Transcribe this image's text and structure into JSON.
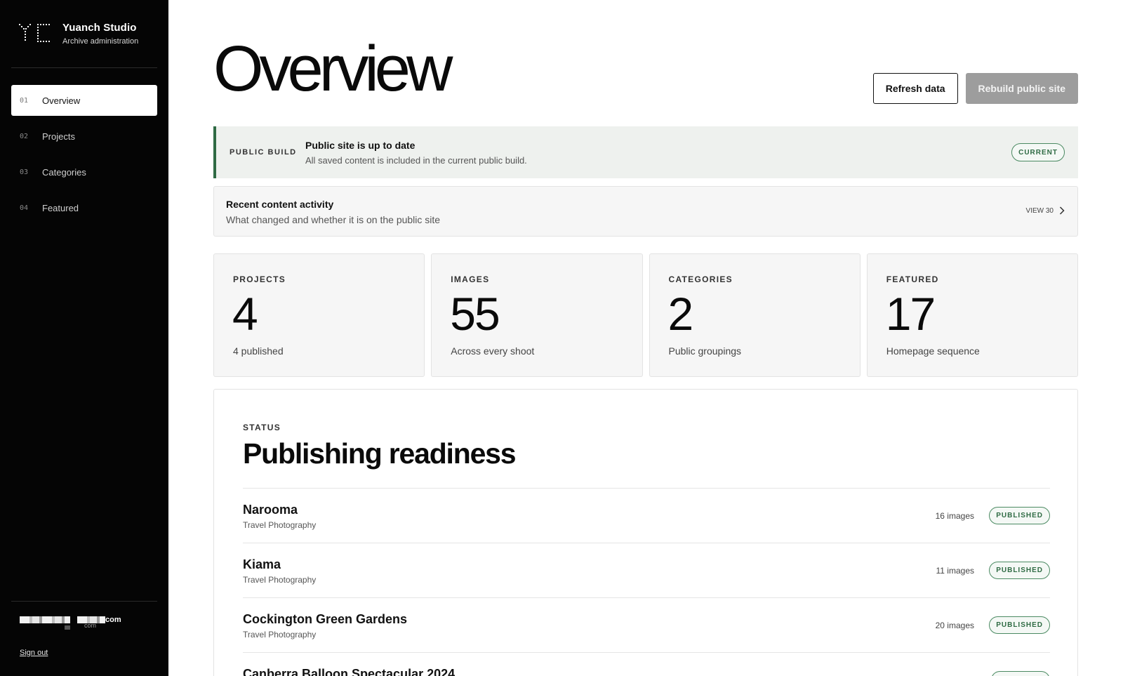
{
  "sidebar": {
    "brand": {
      "name": "Yuanch Studio",
      "subtitle": "Archive administration"
    },
    "nav": [
      {
        "num": "01",
        "label": "Overview",
        "active": true
      },
      {
        "num": "02",
        "label": "Projects",
        "active": false
      },
      {
        "num": "03",
        "label": "Categories",
        "active": false
      },
      {
        "num": "04",
        "label": "Featured",
        "active": false
      }
    ],
    "account": {
      "email_suffix": "com",
      "sub_suffix": "com",
      "sign_out": "Sign out"
    }
  },
  "header": {
    "title": "Overview",
    "refresh_label": "Refresh data",
    "rebuild_label": "Rebuild public site"
  },
  "build_banner": {
    "label": "PUBLIC BUILD",
    "title": "Public site is up to date",
    "description": "All saved content is included in the current public build.",
    "badge": "CURRENT"
  },
  "activity": {
    "title": "Recent content activity",
    "description": "What changed and whether it is on the public site",
    "view_label": "VIEW 30"
  },
  "stats": [
    {
      "label": "PROJECTS",
      "value": "4",
      "note": "4 published"
    },
    {
      "label": "IMAGES",
      "value": "55",
      "note": "Across every shoot"
    },
    {
      "label": "CATEGORIES",
      "value": "2",
      "note": "Public groupings"
    },
    {
      "label": "FEATURED",
      "value": "17",
      "note": "Homepage sequence"
    }
  ],
  "readiness": {
    "eyebrow": "STATUS",
    "title": "Publishing readiness",
    "rows": [
      {
        "name": "Narooma",
        "category": "Travel Photography",
        "count": "16 images",
        "status": "PUBLISHED"
      },
      {
        "name": "Kiama",
        "category": "Travel Photography",
        "count": "11 images",
        "status": "PUBLISHED"
      },
      {
        "name": "Cockington Green Gardens",
        "category": "Travel Photography",
        "count": "20 images",
        "status": "PUBLISHED"
      },
      {
        "name": "Canberra Balloon Spectacular 2024",
        "category": "",
        "count": "",
        "status": ""
      }
    ]
  },
  "colors": {
    "sidebar_bg": "#050505",
    "accent_green": "#2f6b44",
    "banner_bg": "#eef1ee"
  }
}
